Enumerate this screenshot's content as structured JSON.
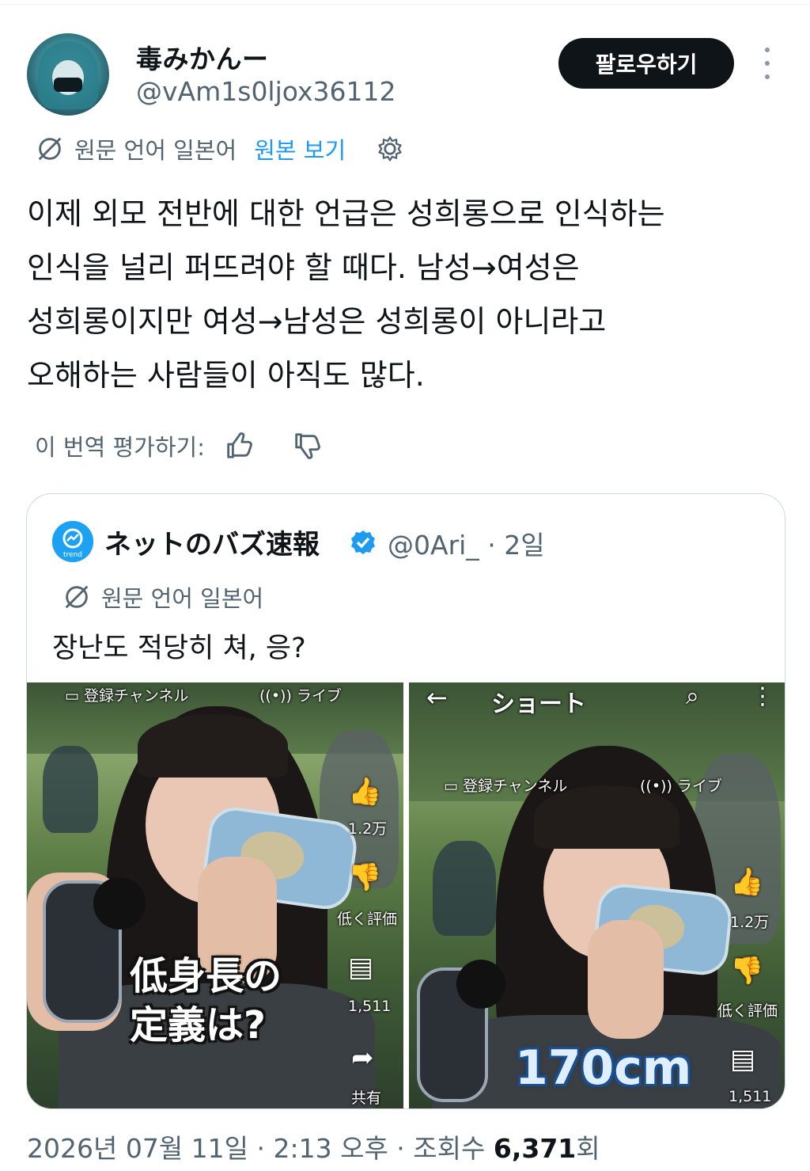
{
  "author": {
    "display_name": "毒みかんー",
    "handle": "@vAm1s0ljox36112"
  },
  "follow_label": "팔로우하기",
  "translation": {
    "source_lang": "원문 언어 일본어",
    "show_original": "원본 보기"
  },
  "tweet_lines": [
    "이제 외모 전반에 대한 언급은 성희롱으로 인식하는",
    "인식을 널리 퍼뜨려야 할 때다. 남성→여성은",
    "성희롱이지만 여성→남성은 성희롱이 아니라고",
    "오해하는 사람들이 아직도 많다."
  ],
  "rate_label": "이 번역 평가하기:",
  "quote": {
    "display_name": "ネットのバズ速報",
    "handle_time": "@0Ari_ · 2일",
    "avatar_text": "trend",
    "source_lang": "원문 언어 일본어",
    "text": "장난도 적당히 쳐, 응?"
  },
  "media_left": {
    "tab_subscribed": "登録チャンネル",
    "tab_live": "ライブ",
    "like_count": "1.2万",
    "dislike_label": "低く評価",
    "comment_count": "1,511",
    "share_label": "共有",
    "caption_line1": "低身長の",
    "caption_line2": "定義は?"
  },
  "media_right": {
    "header_title": "ショート",
    "tab_subscribed": "登録チャンネル",
    "tab_live": "ライブ",
    "like_count": "1.2万",
    "dislike_label": "低く評価",
    "comment_count": "1,511",
    "caption": "170cm"
  },
  "footer": {
    "date_time": "2026년 07월 11일 · 2:13 오후 · 조회수 ",
    "views": "6,371",
    "views_suffix": "회"
  },
  "colors": {
    "link": "#1d9bf0",
    "secondary_text": "#536471",
    "button_bg": "#0f1419",
    "verified": "#1d9bf0"
  },
  "icons": [
    "translate-icon",
    "gear-icon",
    "thumbs-up-icon",
    "thumbs-down-icon",
    "more-icon",
    "verified-badge-icon"
  ]
}
